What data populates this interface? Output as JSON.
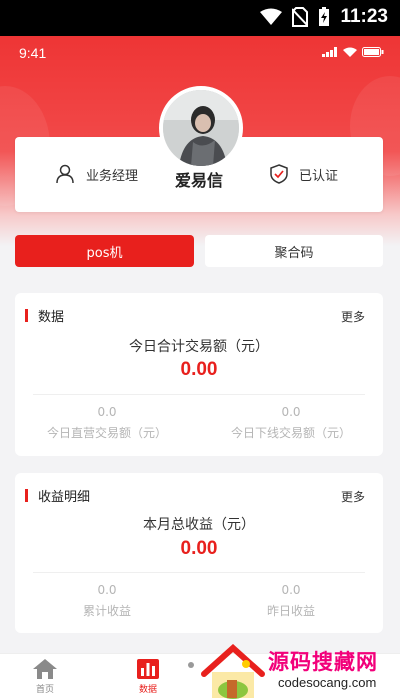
{
  "system_status": {
    "time": "11:23"
  },
  "app_status": {
    "time": "9:41"
  },
  "profile": {
    "role": "业务经理",
    "name": "爱易信",
    "verified": "已认证"
  },
  "tabs": {
    "pos": "pos机",
    "aggregate": "聚合码"
  },
  "data_card": {
    "title": "数据",
    "more": "更多",
    "total_label": "今日合计交易额（元）",
    "total_value": "0.00",
    "direct_value": "0.0",
    "direct_label": "今日直营交易额（元）",
    "downline_value": "0.0",
    "downline_label": "今日下线交易额（元）"
  },
  "income_card": {
    "title": "收益明细",
    "more": "更多",
    "month_label": "本月总收益（元）",
    "month_value": "0.00",
    "cumulative_value": "0.0",
    "cumulative_label": "累计收益",
    "yesterday_value": "0.0",
    "yesterday_label": "昨日收益"
  },
  "bottom_nav": {
    "home": "首页",
    "data": "数据"
  },
  "watermark": {
    "text": "源码搜藏网",
    "url": "codesocang.com"
  },
  "colors": {
    "accent": "#e8201d",
    "header": "#ee3535",
    "watermark": "#f2007a"
  }
}
